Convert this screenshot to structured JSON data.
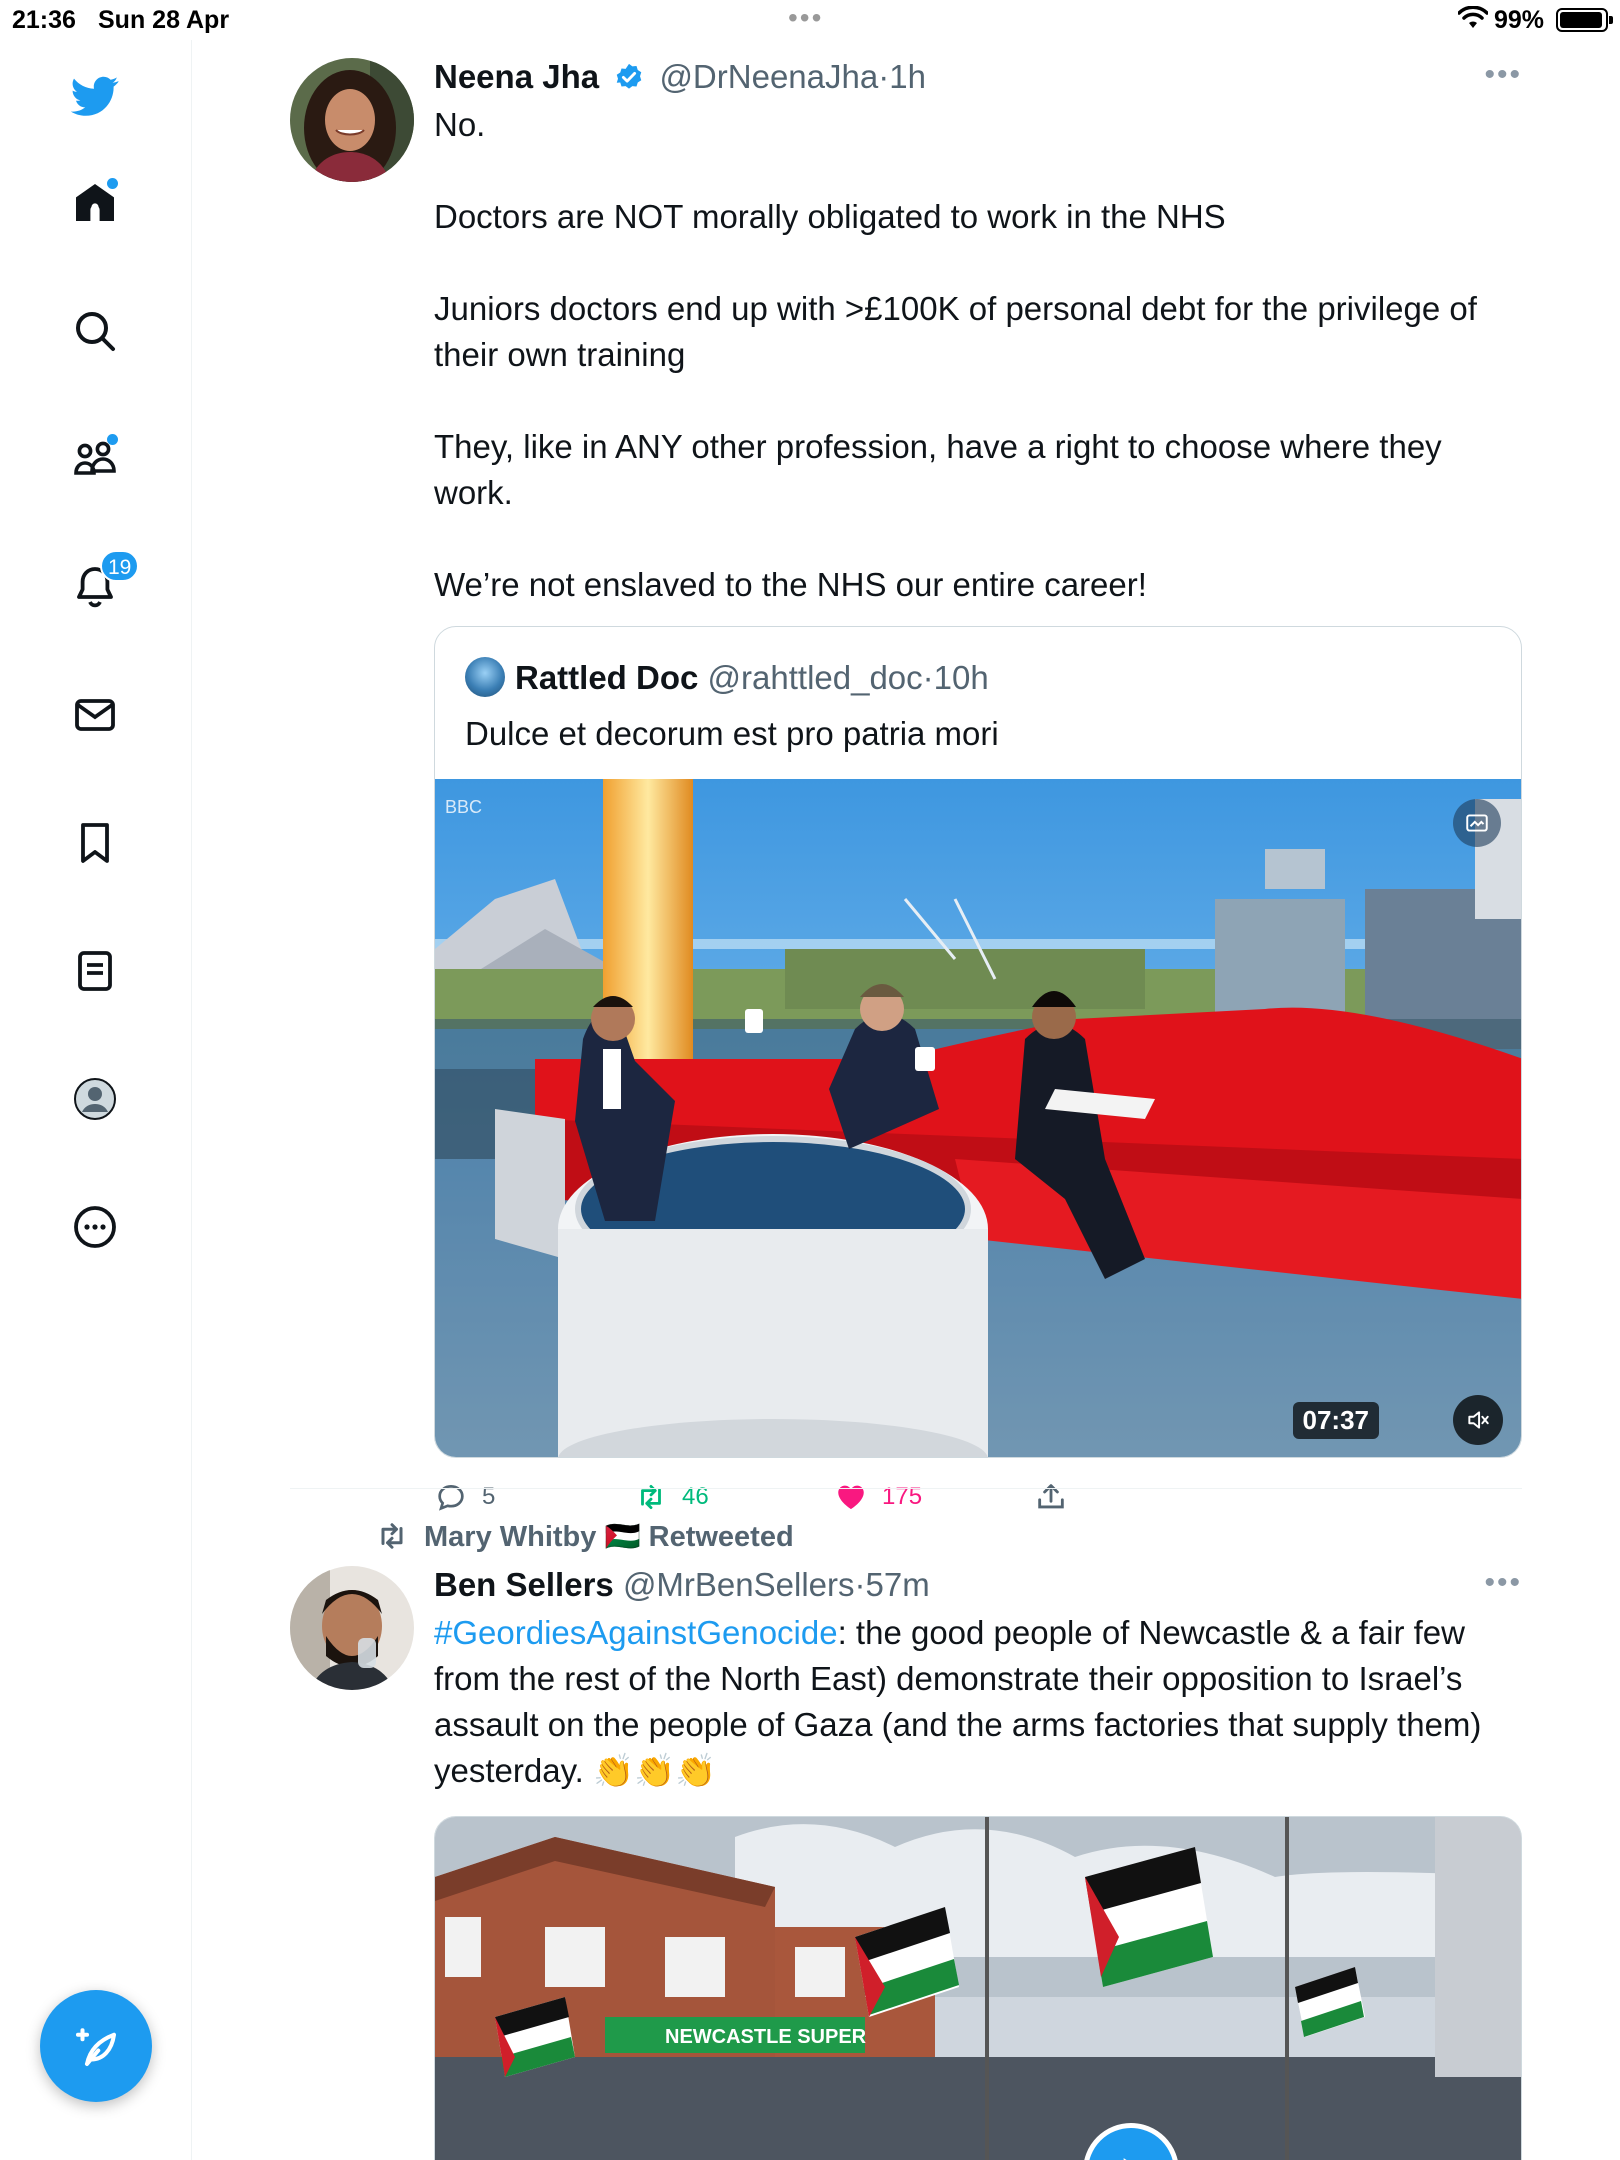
{
  "status_bar": {
    "time": "21:36",
    "date": "Sun 28 Apr",
    "battery": "99%"
  },
  "sidebar": {
    "notifications_count": "19",
    "items": [
      {
        "name": "twitter-logo-icon"
      },
      {
        "name": "home-icon"
      },
      {
        "name": "search-icon"
      },
      {
        "name": "communities-icon"
      },
      {
        "name": "bell-icon"
      },
      {
        "name": "mail-icon"
      },
      {
        "name": "bookmark-icon"
      },
      {
        "name": "lists-icon"
      },
      {
        "name": "profile-icon"
      },
      {
        "name": "more-icon"
      }
    ]
  },
  "tweet1": {
    "name": "Neena Jha",
    "handle": "@DrNeenaJha",
    "sep": "·",
    "time": "1h",
    "text": "No.\n\nDoctors are NOT morally obligated to work in the NHS\n\nJuniors doctors end up with >£100K of personal debt for the privilege of their own training\n\nThey, like in ANY other profession, have a right to choose where they work.\n\nWe’re not enslaved to the NHS our entire career!",
    "quote": {
      "name": "Rattled Doc",
      "handle": "@rahttled_doc",
      "sep": "·",
      "time": "10h",
      "text": "Dulce et decorum est pro patria mori",
      "video_duration": "07:37"
    },
    "replies": "5",
    "retweets": "46",
    "likes": "175"
  },
  "tweet2": {
    "retweeted_by": "Mary Whitby 🇵🇸 Retweeted",
    "name": "Ben Sellers",
    "handle": "@MrBenSellers",
    "sep": "·",
    "time": "57m",
    "hashtag": "#GeordiesAgainstGenocide",
    "text": ": the good people of Newcastle & a fair few from the rest of the North East) demonstrate their opposition to Israel’s assault on the people of Gaza (and the arms factories that supply them) yesterday. 👏👏👏"
  },
  "colors": {
    "accent": "#1d9bf0",
    "like": "#f91880",
    "retweet": "#00ba7c",
    "muted_text": "#536471"
  }
}
